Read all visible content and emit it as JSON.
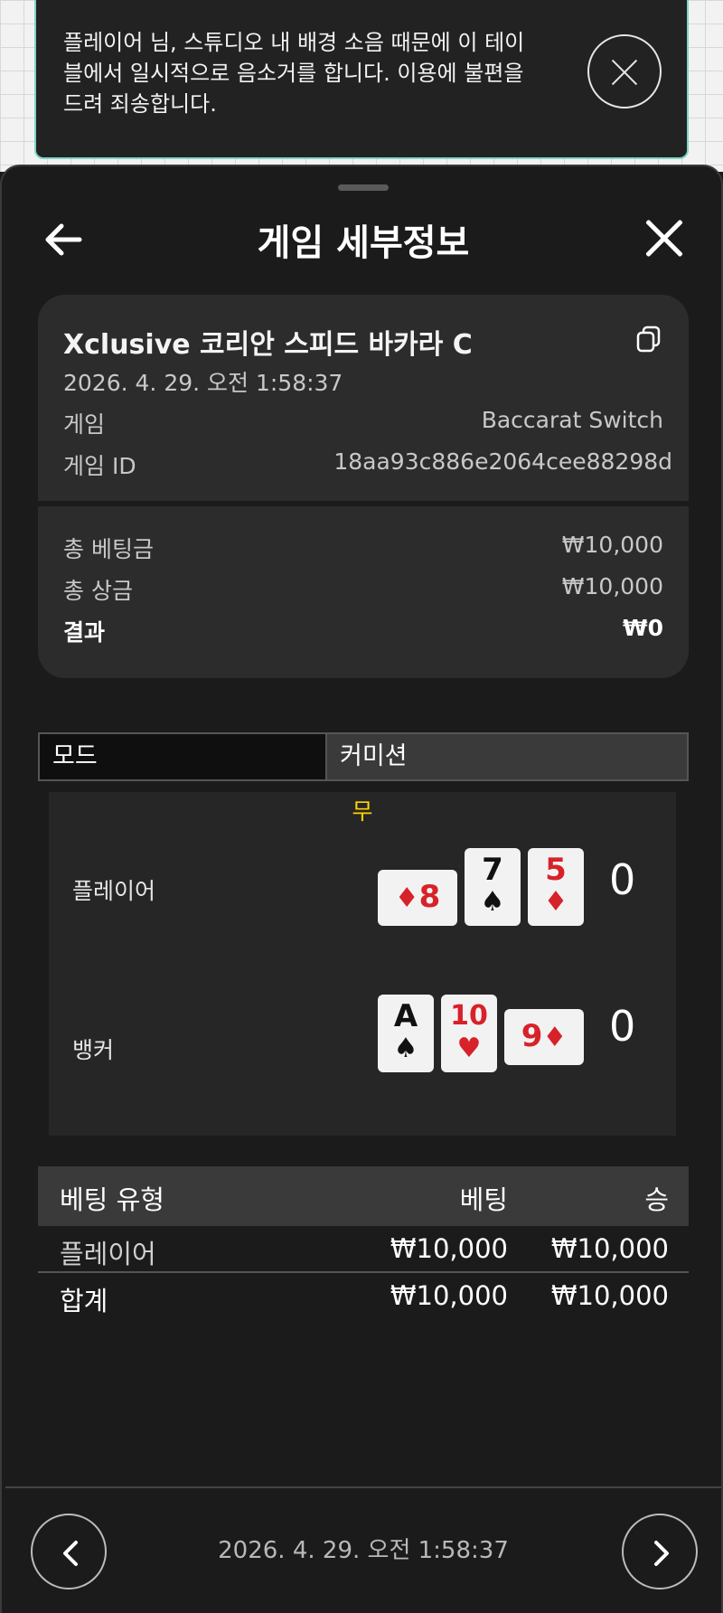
{
  "notice": {
    "text": "플레이어 님, 스튜디오 내 배경 소음 때문에 이 테이블에서 일시적으로 음소거를 합니다. 이용에 불편을 드려 죄송합니다."
  },
  "header": {
    "title": "게임 세부정보"
  },
  "game": {
    "name": "Xclusive 코리안 스피드 바카라 C",
    "datetime": "2026. 4. 29. 오전 1:58:37",
    "game_label": "게임",
    "game_value": "Baccarat Switch",
    "id_label": "게임 ID",
    "id_value": "18aa93c886e2064cee88298d"
  },
  "summary": {
    "total_bet_label": "총 베팅금",
    "total_bet_value": "₩10,000",
    "total_win_label": "총 상금",
    "total_win_value": "₩10,000",
    "result_label": "결과",
    "result_value": "₩0"
  },
  "tabs": {
    "mode": "모드",
    "commission": "커미션"
  },
  "round": {
    "outcome": "무",
    "player": {
      "label": "플레이어",
      "score": "0",
      "cards": [
        {
          "rank": "8",
          "suit": "♦",
          "color": "red",
          "sideways": true
        },
        {
          "rank": "7",
          "suit": "♠",
          "color": "black"
        },
        {
          "rank": "5",
          "suit": "♦",
          "color": "red"
        }
      ]
    },
    "banker": {
      "label": "뱅커",
      "score": "0",
      "cards": [
        {
          "rank": "A",
          "suit": "♠",
          "color": "black"
        },
        {
          "rank": "10",
          "suit": "♥",
          "color": "red"
        },
        {
          "rank": "9",
          "suit": "♦",
          "color": "red",
          "sideways": true
        }
      ]
    }
  },
  "bets_table": {
    "headers": [
      "베팅 유형",
      "베팅",
      "승"
    ],
    "rows": [
      [
        "플레이어",
        "₩10,000",
        "₩10,000"
      ]
    ],
    "total": [
      "합계",
      "₩10,000",
      "₩10,000"
    ]
  },
  "footer": {
    "datetime": "2026. 4. 29. 오전 1:58:37"
  }
}
